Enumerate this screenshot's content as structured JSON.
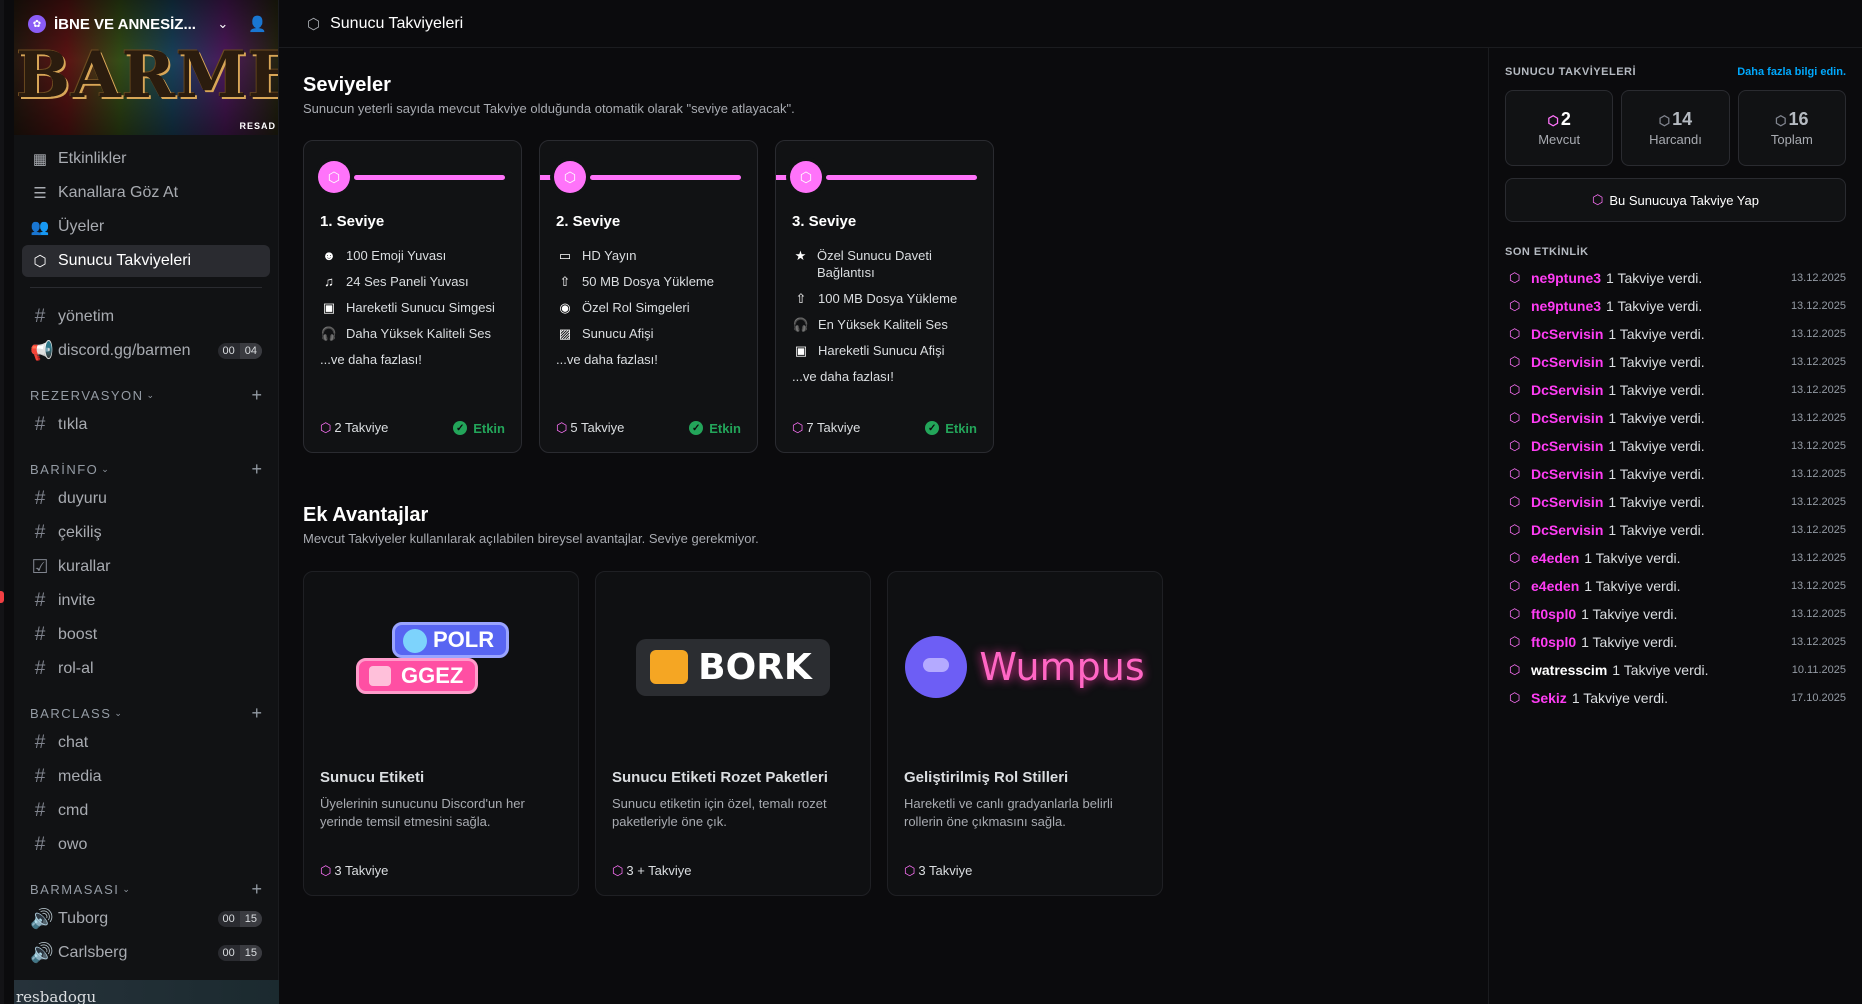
{
  "server": {
    "name": "İBNE VE ANNESİZ...",
    "banner_text": "BARMEN",
    "banner_tag": "RESAD"
  },
  "nav": [
    {
      "icon": "calendar-icon",
      "glyph": "▦",
      "label": "Etkinlikler"
    },
    {
      "icon": "browse-channels-icon",
      "glyph": "☰",
      "label": "Kanallara Göz At"
    },
    {
      "icon": "members-icon",
      "glyph": "👥",
      "label": "Üyeler"
    },
    {
      "icon": "boost-icon",
      "glyph": "⬡",
      "label": "Sunucu Takviyeleri"
    }
  ],
  "top_channels": [
    {
      "icon": "text-channel-icon",
      "glyph": "#",
      "label": "yönetim"
    },
    {
      "icon": "announcement-icon",
      "glyph": "📢",
      "label": "discord.gg/barmen",
      "count_a": "00",
      "count_b": "04"
    }
  ],
  "categories": [
    {
      "name": "REZERVASYON",
      "channels": [
        {
          "glyph": "#",
          "label": "tıkla"
        }
      ]
    },
    {
      "name": "BARİNFO",
      "channels": [
        {
          "glyph": "#",
          "label": "duyuru"
        },
        {
          "glyph": "#",
          "label": "çekiliş"
        },
        {
          "glyph": "☑",
          "label": "kurallar"
        },
        {
          "glyph": "#",
          "label": "invite"
        },
        {
          "glyph": "#",
          "label": "boost"
        },
        {
          "glyph": "#",
          "label": "rol-al"
        }
      ]
    },
    {
      "name": "BARCLASS",
      "channels": [
        {
          "glyph": "#",
          "label": "chat"
        },
        {
          "glyph": "#",
          "label": "media"
        },
        {
          "glyph": "#",
          "label": "cmd"
        },
        {
          "glyph": "#",
          "label": "owo"
        }
      ]
    },
    {
      "name": "BARMASASI",
      "channels": [
        {
          "glyph": "🔊",
          "label": "Tuborg",
          "count_a": "00",
          "count_b": "15"
        },
        {
          "glyph": "🔊",
          "label": "Carlsberg",
          "count_a": "00",
          "count_b": "15"
        }
      ]
    }
  ],
  "user_bar": {
    "name": "resbadogu"
  },
  "header": {
    "title": "Sunucu Takviyeleri"
  },
  "levels": {
    "title": "Seviyeler",
    "subtitle": "Sunucun yeterli sayıda mevcut Takviye olduğunda otomatik olarak \"seviye atlayacak\".",
    "tiers": [
      {
        "name": "1. Seviye",
        "perks": [
          {
            "icon": "emoji-icon",
            "glyph": "☻",
            "text": "100 Emoji Yuvası"
          },
          {
            "icon": "soundboard-icon",
            "glyph": "♫",
            "text": "24 Ses Paneli Yuvası"
          },
          {
            "icon": "gif-icon",
            "glyph": "▣",
            "text": "Hareketli Sunucu Simgesi"
          },
          {
            "icon": "headphones-icon",
            "glyph": "🎧",
            "text": "Daha Yüksek Kaliteli Ses"
          }
        ],
        "more": "...ve daha fazlası!",
        "cost": "2 Takviye",
        "status": "Etkin"
      },
      {
        "name": "2. Seviye",
        "perks": [
          {
            "icon": "stream-icon",
            "glyph": "▭",
            "text": "HD Yayın"
          },
          {
            "icon": "upload-icon",
            "glyph": "⇧",
            "text": "50 MB Dosya Yükleme"
          },
          {
            "icon": "role-icon",
            "glyph": "◉",
            "text": "Özel Rol Simgeleri"
          },
          {
            "icon": "image-icon",
            "glyph": "▨",
            "text": "Sunucu Afişi"
          }
        ],
        "more": "...ve daha fazlası!",
        "cost": "5 Takviye",
        "status": "Etkin"
      },
      {
        "name": "3. Seviye",
        "perks": [
          {
            "icon": "star-icon",
            "glyph": "★",
            "text": "Özel Sunucu Daveti Bağlantısı"
          },
          {
            "icon": "upload-icon",
            "glyph": "⇧",
            "text": "100 MB Dosya Yükleme"
          },
          {
            "icon": "headphones-icon",
            "glyph": "🎧",
            "text": "En Yüksek Kaliteli Ses"
          },
          {
            "icon": "gif-icon",
            "glyph": "▣",
            "text": "Hareketli Sunucu Afişi"
          }
        ],
        "more": "...ve daha fazlası!",
        "cost": "7 Takviye",
        "status": "Etkin"
      }
    ]
  },
  "perks": {
    "title": "Ek Avantajlar",
    "subtitle": "Mevcut Takviyeler kullanılarak açılabilen bireysel avantajlar. Seviye gerekmiyor.",
    "cards": [
      {
        "title": "Sunucu Etiketi",
        "desc": "Üyelerinin sunucunu Discord'un her yerinde temsil etmesini sağla.",
        "cost": "3 Takviye",
        "art_a": "POLR",
        "art_b": "GGEZ"
      },
      {
        "title": "Sunucu Etiketi Rozet Paketleri",
        "desc": "Sunucu etiketin için özel, temalı rozet paketleriyle öne çık.",
        "cost": "3 + Takviye",
        "art_a": "BORK"
      },
      {
        "title": "Geliştirilmiş Rol Stilleri",
        "desc": "Hareketli ve canlı gradyanlarla belirli rollerin öne çıkmasını sağla.",
        "cost": "3 Takviye",
        "art_a": "Wumpus"
      }
    ]
  },
  "sidebar_right": {
    "title": "SUNUCU TAKVİYELERİ",
    "link": "Daha fazla bilgi edin.",
    "stats": [
      {
        "value": "2",
        "label": "Mevcut"
      },
      {
        "value": "14",
        "label": "Harcandı"
      },
      {
        "value": "16",
        "label": "Toplam"
      }
    ],
    "boost_button": "Bu Sunucuya Takviye Yap",
    "activity_title": "SON ETKİNLİK",
    "activity": [
      {
        "user": "ne9ptune3",
        "text": "1 Takviye verdi.",
        "date": "13.12.2025",
        "color": "pink"
      },
      {
        "user": "ne9ptune3",
        "text": "1 Takviye verdi.",
        "date": "13.12.2025",
        "color": "pink"
      },
      {
        "user": "DcServisin",
        "text": "1 Takviye verdi.",
        "date": "13.12.2025",
        "color": "pink"
      },
      {
        "user": "DcServisin",
        "text": "1 Takviye verdi.",
        "date": "13.12.2025",
        "color": "pink"
      },
      {
        "user": "DcServisin",
        "text": "1 Takviye verdi.",
        "date": "13.12.2025",
        "color": "pink"
      },
      {
        "user": "DcServisin",
        "text": "1 Takviye verdi.",
        "date": "13.12.2025",
        "color": "pink"
      },
      {
        "user": "DcServisin",
        "text": "1 Takviye verdi.",
        "date": "13.12.2025",
        "color": "pink"
      },
      {
        "user": "DcServisin",
        "text": "1 Takviye verdi.",
        "date": "13.12.2025",
        "color": "pink"
      },
      {
        "user": "DcServisin",
        "text": "1 Takviye verdi.",
        "date": "13.12.2025",
        "color": "pink"
      },
      {
        "user": "DcServisin",
        "text": "1 Takviye verdi.",
        "date": "13.12.2025",
        "color": "pink"
      },
      {
        "user": "e4eden",
        "text": "1 Takviye verdi.",
        "date": "13.12.2025",
        "color": "pink"
      },
      {
        "user": "e4eden",
        "text": "1 Takviye verdi.",
        "date": "13.12.2025",
        "color": "pink"
      },
      {
        "user": "ft0spl0",
        "text": "1 Takviye verdi.",
        "date": "13.12.2025",
        "color": "pink"
      },
      {
        "user": "ft0spl0",
        "text": "1 Takviye verdi.",
        "date": "13.12.2025",
        "color": "pink"
      },
      {
        "user": "watresscim",
        "text": "1 Takviye verdi.",
        "date": "10.11.2025",
        "color": "white"
      },
      {
        "user": "Sekiz",
        "text": "1 Takviye verdi.",
        "date": "17.10.2025",
        "color": "pink"
      }
    ]
  },
  "colors": {
    "accent": "#ff73fa",
    "active": "#23a55a",
    "link": "#00a8fc"
  }
}
